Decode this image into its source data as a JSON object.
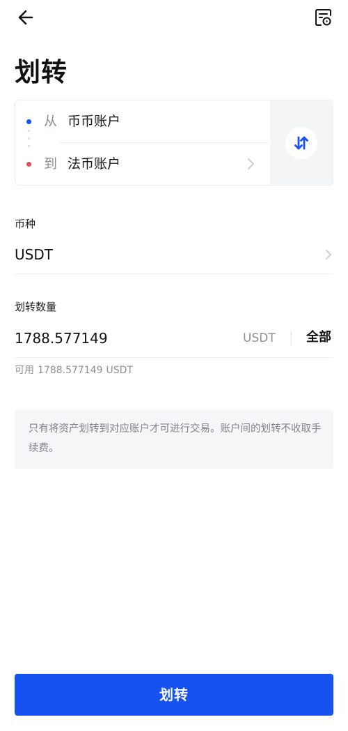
{
  "header": {
    "back_icon": "arrow-left-icon",
    "records_icon": "transfer-record-icon"
  },
  "page_title": "划转",
  "transfer": {
    "from_prefix": "从",
    "from_account": "币币账户",
    "to_prefix": "到",
    "to_account": "法币账户",
    "swap_icon": "swap-vertical-arrows-icon",
    "colors": {
      "from_dot": "#1652f0",
      "to_dot": "#d9515f"
    }
  },
  "coin": {
    "label": "币种",
    "value": "USDT"
  },
  "amount": {
    "label": "划转数量",
    "value": "1788.577149",
    "unit": "USDT",
    "all_label": "全部"
  },
  "available": {
    "label": "可用",
    "value": "1788.577149",
    "unit": "USDT"
  },
  "notice": "只有将资产划转到对应账户才可进行交易。账户间的划转不收取手续费。",
  "submit_label": "划转",
  "colors": {
    "primary": "#1652f0"
  }
}
